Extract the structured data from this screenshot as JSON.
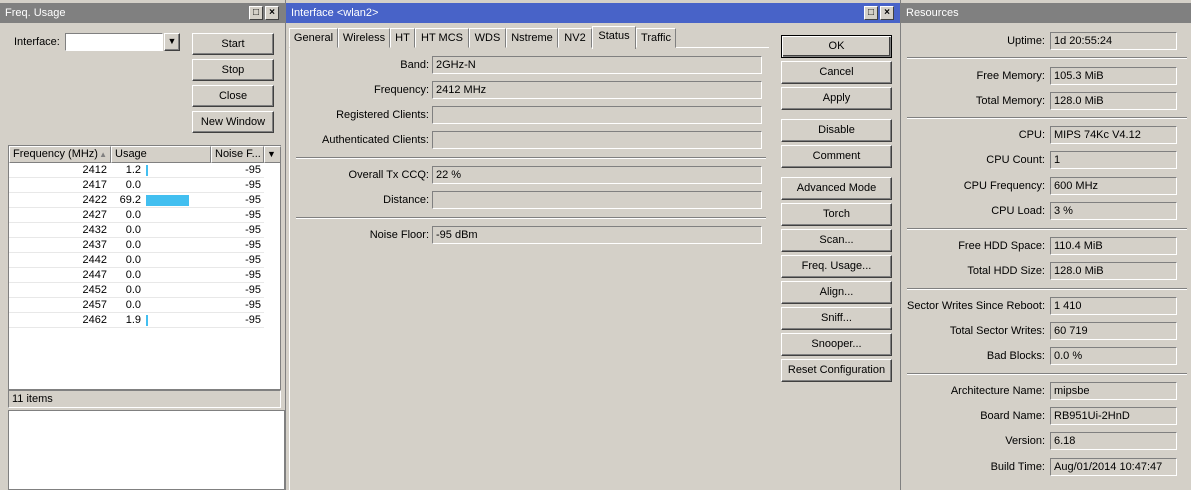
{
  "freq_window": {
    "title": "Freq. Usage",
    "interface_label": "Interface:",
    "interface_value": "",
    "buttons": {
      "start": "Start",
      "stop": "Stop",
      "close": "Close",
      "new_window": "New Window"
    },
    "columns": {
      "frequency": "Frequency (MHz)",
      "usage": "Usage",
      "noise": "Noise F..."
    },
    "rows": [
      {
        "frequency": "2412",
        "usage": "1.2",
        "usage_pct": 1.2,
        "noise": "-95"
      },
      {
        "frequency": "2417",
        "usage": "0.0",
        "usage_pct": 0.0,
        "noise": "-95"
      },
      {
        "frequency": "2422",
        "usage": "69.2",
        "usage_pct": 69.2,
        "noise": "-95"
      },
      {
        "frequency": "2427",
        "usage": "0.0",
        "usage_pct": 0.0,
        "noise": "-95"
      },
      {
        "frequency": "2432",
        "usage": "0.0",
        "usage_pct": 0.0,
        "noise": "-95"
      },
      {
        "frequency": "2437",
        "usage": "0.0",
        "usage_pct": 0.0,
        "noise": "-95"
      },
      {
        "frequency": "2442",
        "usage": "0.0",
        "usage_pct": 0.0,
        "noise": "-95"
      },
      {
        "frequency": "2447",
        "usage": "0.0",
        "usage_pct": 0.0,
        "noise": "-95"
      },
      {
        "frequency": "2452",
        "usage": "0.0",
        "usage_pct": 0.0,
        "noise": "-95"
      },
      {
        "frequency": "2457",
        "usage": "0.0",
        "usage_pct": 0.0,
        "noise": "-95"
      },
      {
        "frequency": "2462",
        "usage": "1.9",
        "usage_pct": 1.9,
        "noise": "-95"
      }
    ],
    "item_count": "11 items",
    "bar_color": "#42bff0"
  },
  "interface_window": {
    "title": "Interface <wlan2>",
    "tabs": [
      "General",
      "Wireless",
      "HT",
      "HT MCS",
      "WDS",
      "Nstreme",
      "NV2",
      "Status",
      "Traffic"
    ],
    "selected_tab": "Status",
    "fields": {
      "band": {
        "label": "Band:",
        "value": "2GHz-N"
      },
      "frequency": {
        "label": "Frequency:",
        "value": "2412 MHz"
      },
      "registered_clients": {
        "label": "Registered Clients:",
        "value": ""
      },
      "authenticated_clients": {
        "label": "Authenticated Clients:",
        "value": ""
      },
      "overall_tx_ccq": {
        "label": "Overall Tx CCQ:",
        "value": "22 %"
      },
      "distance": {
        "label": "Distance:",
        "value": ""
      },
      "noise_floor": {
        "label": "Noise Floor:",
        "value": "-95 dBm"
      }
    },
    "buttons": {
      "ok": "OK",
      "cancel": "Cancel",
      "apply": "Apply",
      "disable": "Disable",
      "comment": "Comment",
      "advanced_mode": "Advanced Mode",
      "torch": "Torch",
      "scan": "Scan...",
      "freq_usage": "Freq. Usage...",
      "align": "Align...",
      "sniff": "Sniff...",
      "snooper": "Snooper...",
      "reset_configuration": "Reset Configuration"
    },
    "title_color": "#4863c8"
  },
  "resources_window": {
    "title": "Resources",
    "fields": {
      "uptime": {
        "label": "Uptime:",
        "value": "1d 20:55:24"
      },
      "free_memory": {
        "label": "Free Memory:",
        "value": "105.3 MiB"
      },
      "total_memory": {
        "label": "Total Memory:",
        "value": "128.0 MiB"
      },
      "cpu": {
        "label": "CPU:",
        "value": "MIPS 74Kc V4.12"
      },
      "cpu_count": {
        "label": "CPU Count:",
        "value": "1"
      },
      "cpu_frequency": {
        "label": "CPU Frequency:",
        "value": "600 MHz"
      },
      "cpu_load": {
        "label": "CPU Load:",
        "value": "3 %"
      },
      "free_hdd_space": {
        "label": "Free HDD Space:",
        "value": "110.4 MiB"
      },
      "total_hdd_size": {
        "label": "Total HDD Size:",
        "value": "128.0 MiB"
      },
      "sector_writes_since_reboot": {
        "label": "Sector Writes Since Reboot:",
        "value": "1 410"
      },
      "total_sector_writes": {
        "label": "Total Sector Writes:",
        "value": "60 719"
      },
      "bad_blocks": {
        "label": "Bad Blocks:",
        "value": "0.0 %"
      },
      "architecture_name": {
        "label": "Architecture Name:",
        "value": "mipsbe"
      },
      "board_name": {
        "label": "Board Name:",
        "value": "RB951Ui-2HnD"
      },
      "version": {
        "label": "Version:",
        "value": "6.18"
      },
      "build_time": {
        "label": "Build Time:",
        "value": "Aug/01/2014 10:47:47"
      }
    }
  }
}
